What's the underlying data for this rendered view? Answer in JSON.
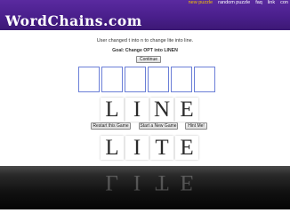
{
  "header": {
    "logo_text": "WordChains.com",
    "nav": [
      "new puzzle",
      "random puzzle",
      "faq",
      "link",
      "con"
    ]
  },
  "messages": {
    "changed": "User changed t into n to change lite into line.",
    "goal": "Goal: Change OPT into LINEN"
  },
  "buttons": {
    "continue": "Continue",
    "restart": "Restart this Game",
    "new_game": "Start a New Game",
    "hint": "Hint Me!"
  },
  "input_boxes": [
    "",
    "",
    "",
    "",
    "",
    ""
  ],
  "current_word": [
    "L",
    "I",
    "N",
    "E"
  ],
  "previous_word": [
    "L",
    "I",
    "T",
    "E"
  ],
  "colors": {
    "header": "#4a1f8c",
    "active_nav": "#f2c200",
    "box_border": "#6b7fd7"
  }
}
